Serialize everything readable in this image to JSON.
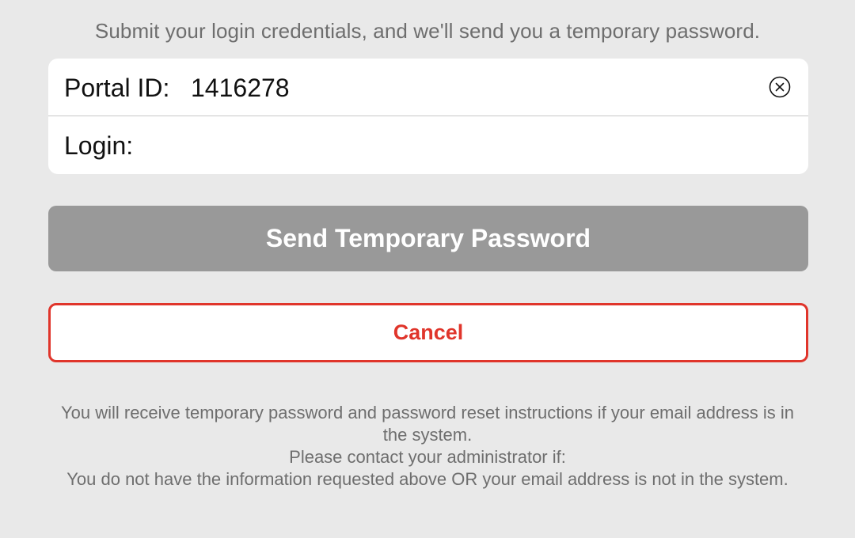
{
  "intro_text": "Submit your login credentials, and we'll send you a temporary password.",
  "form": {
    "portal_id": {
      "label": "Portal ID:",
      "value": "1416278",
      "clear_icon": "clear-circle-x-icon"
    },
    "login": {
      "label": "Login:",
      "value": ""
    }
  },
  "buttons": {
    "send_label": "Send Temporary Password",
    "cancel_label": "Cancel"
  },
  "info": {
    "line1": "You will receive temporary password and password reset instructions if your email address is in the system.",
    "line2": "Please contact your administrator if:",
    "line3": "You do not have the information requested above OR your email address is not in the system."
  },
  "colors": {
    "background": "#e9e9e9",
    "card": "#ffffff",
    "primary_button_disabled": "#999999",
    "cancel_accent": "#e0352b",
    "muted_text": "#6e6e6e"
  }
}
